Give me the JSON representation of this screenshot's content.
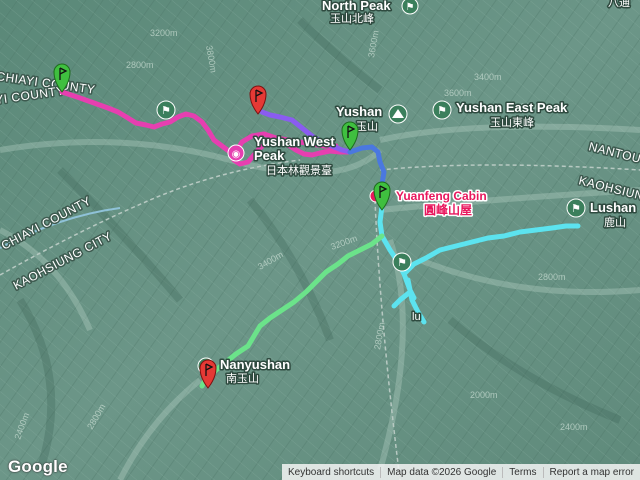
{
  "map": {
    "type": "terrain",
    "attribution": "Google"
  },
  "labels": {
    "north_peak_en": "North Peak",
    "north_peak_zh": "玉山北峰",
    "yushan_en": "Yushan",
    "yushan_zh": "玉山",
    "east_peak_en": "Yushan East Peak",
    "east_peak_zh": "玉山東峰",
    "west_peak_en_1": "Yushan West",
    "west_peak_en_2": "Peak",
    "west_peak_zh": "日本林觀景臺",
    "cabin_en": "Yuanfeng Cabin",
    "cabin_zh": "圓峰山屋",
    "lushan_en": "Lushan",
    "lushan_zh": "鹿山",
    "nanyushan_en": "Nanyushan",
    "nanyushan_zh": "南玉山",
    "chiayi_county_top": "CHIAYI COUNTY",
    "chiayi_county_top2": "YI COUNTY",
    "chiayi_county": "CHIAYI COUNTY",
    "kaohsiung_city": "KAOHSIUNG CITY",
    "nantou": "NANTOU",
    "kaohsiung_right": "KAOHSIUN",
    "top_right_zh": "八通",
    "lu_mark": "lu"
  },
  "contours": [
    "2800m",
    "3200m",
    "3400m",
    "3600m",
    "3800m",
    "3200m",
    "2800m",
    "2400m",
    "3400m",
    "2800m",
    "3200m",
    "2400m",
    "2000m",
    "3600m",
    "2800m"
  ],
  "markers": [
    {
      "name": "start",
      "color": "#3fbf3f"
    },
    {
      "name": "west-peak-flag",
      "color": "#e53935"
    },
    {
      "name": "yushan-flag",
      "color": "#3fbf3f"
    },
    {
      "name": "cabin-flag",
      "color": "#3fbf3f"
    },
    {
      "name": "end",
      "color": "#e53935"
    }
  ],
  "routes": [
    {
      "name": "pink-route",
      "color": "#e63fb0"
    },
    {
      "name": "purple-route",
      "color": "#8a5cf0"
    },
    {
      "name": "blue-route",
      "color": "#4a78e0"
    },
    {
      "name": "cyan-route",
      "color": "#5ce3ef"
    },
    {
      "name": "green-route",
      "color": "#6be38a"
    }
  ],
  "footer": {
    "keyboard": "Keyboard shortcuts",
    "map_data": "Map data ©2026 Google",
    "terms": "Terms",
    "report": "Report a map error"
  }
}
